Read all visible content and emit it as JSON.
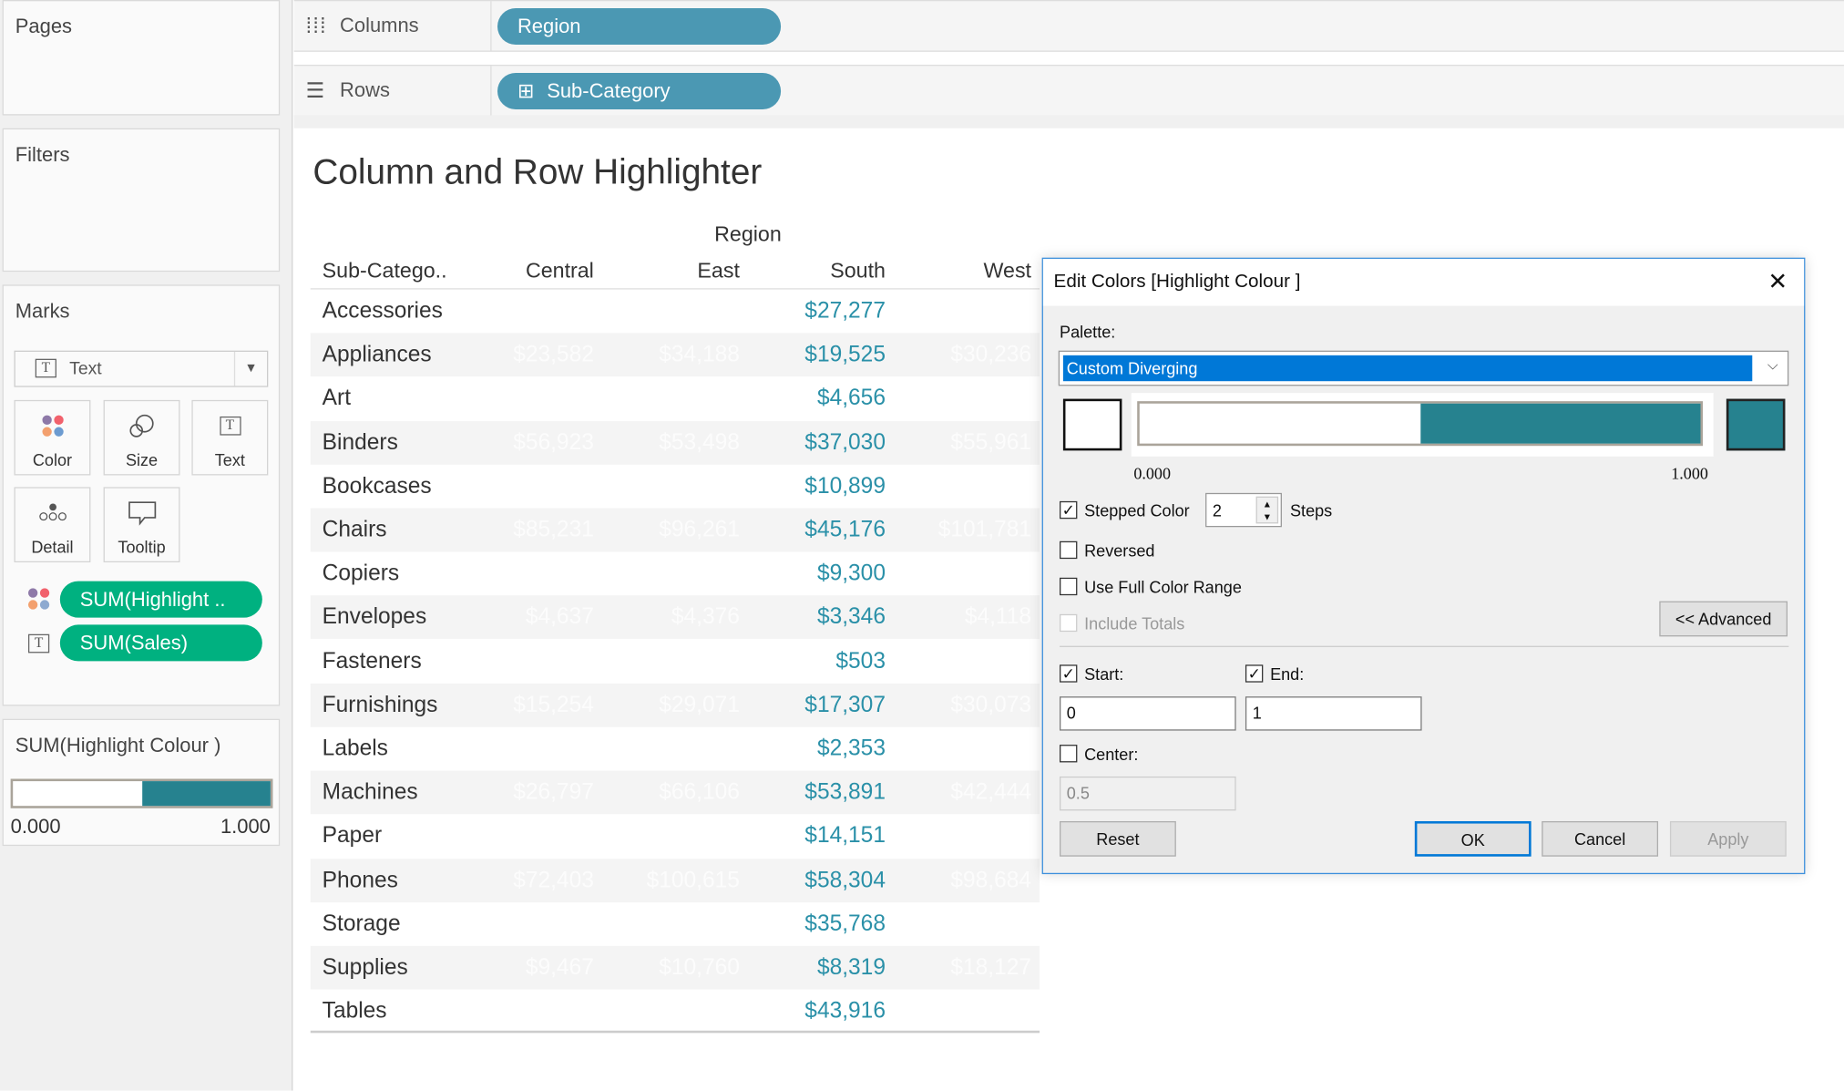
{
  "left": {
    "pages": "Pages",
    "filters": "Filters",
    "marks": {
      "title": "Marks",
      "type": "Text",
      "buttons": [
        "Color",
        "Size",
        "Text",
        "Detail",
        "Tooltip"
      ],
      "pills": [
        "SUM(Highlight ..",
        "SUM(Sales)"
      ]
    },
    "legend": {
      "title": "SUM(Highlight Colour )",
      "min": "0.000",
      "max": "1.000",
      "fraction": 0.5
    }
  },
  "shelves": {
    "columns_label": "Columns",
    "columns_pill": "Region",
    "rows_label": "Rows",
    "rows_pill": "Sub-Category"
  },
  "colors": {
    "pill_dimension": "#4b98b3",
    "pill_measure": "#00b180",
    "teal": "#26828f",
    "value_text": "#2a90a8",
    "selection": "#0078d7"
  },
  "viz": {
    "title": "Column and Row Highlighter",
    "region_header": "Region",
    "rows_header": "Sub-Catego..",
    "columns": [
      "Central",
      "East",
      "South",
      "West"
    ],
    "rows": [
      {
        "name": "Accessories",
        "values": [
          "",
          "",
          "$27,277",
          ""
        ]
      },
      {
        "name": "Appliances",
        "values": [
          "$23,582",
          "$34,188",
          "$19,525",
          "$30,236"
        ]
      },
      {
        "name": "Art",
        "values": [
          "",
          "",
          "$4,656",
          ""
        ]
      },
      {
        "name": "Binders",
        "values": [
          "$56,923",
          "$53,498",
          "$37,030",
          "$55,961"
        ]
      },
      {
        "name": "Bookcases",
        "values": [
          "",
          "",
          "$10,899",
          ""
        ]
      },
      {
        "name": "Chairs",
        "values": [
          "$85,231",
          "$96,261",
          "$45,176",
          "$101,781"
        ]
      },
      {
        "name": "Copiers",
        "values": [
          "",
          "",
          "$9,300",
          ""
        ]
      },
      {
        "name": "Envelopes",
        "values": [
          "$4,637",
          "$4,376",
          "$3,346",
          "$4,118"
        ]
      },
      {
        "name": "Fasteners",
        "values": [
          "",
          "",
          "$503",
          ""
        ]
      },
      {
        "name": "Furnishings",
        "values": [
          "$15,254",
          "$29,071",
          "$17,307",
          "$30,073"
        ]
      },
      {
        "name": "Labels",
        "values": [
          "",
          "",
          "$2,353",
          ""
        ]
      },
      {
        "name": "Machines",
        "values": [
          "$26,797",
          "$66,106",
          "$53,891",
          "$42,444"
        ]
      },
      {
        "name": "Paper",
        "values": [
          "",
          "",
          "$14,151",
          ""
        ]
      },
      {
        "name": "Phones",
        "values": [
          "$72,403",
          "$100,615",
          "$58,304",
          "$98,684"
        ]
      },
      {
        "name": "Storage",
        "values": [
          "",
          "",
          "$35,768",
          ""
        ]
      },
      {
        "name": "Supplies",
        "values": [
          "$9,467",
          "$10,760",
          "$8,319",
          "$18,127"
        ]
      },
      {
        "name": "Tables",
        "values": [
          "",
          "",
          "$43,916",
          ""
        ]
      }
    ]
  },
  "dialog": {
    "title": "Edit Colors [Highlight Colour ]",
    "palette_label": "Palette:",
    "palette_value": "Custom Diverging",
    "range_min": "0.000",
    "range_max": "1.000",
    "stepped_color": "Stepped Color",
    "stepped_checked": true,
    "steps": "2",
    "steps_label": "Steps",
    "reversed": "Reversed",
    "full_range": "Use Full Color Range",
    "include_totals": "Include Totals",
    "advanced": "<< Advanced",
    "start_label": "Start:",
    "start_value": "0",
    "end_label": "End:",
    "end_value": "1",
    "center_label": "Center:",
    "center_value": "0.5",
    "reset": "Reset",
    "ok": "OK",
    "cancel": "Cancel",
    "apply": "Apply"
  }
}
